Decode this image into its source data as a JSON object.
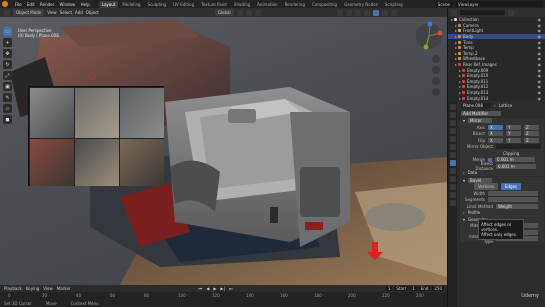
{
  "topbar": {
    "menus": [
      "File",
      "Edit",
      "Render",
      "Window",
      "Help"
    ],
    "workspaces": [
      "Layout",
      "Modeling",
      "Sculpting",
      "UV Editing",
      "Texture Paint",
      "Shading",
      "Animation",
      "Rendering",
      "Compositing",
      "Geometry Nodes",
      "Scripting"
    ],
    "active_workspace": "Layout",
    "scene": "Scene",
    "view_layer": "ViewLayer"
  },
  "viewport_header": {
    "mode": "Object Mode",
    "menus": [
      "View",
      "Select",
      "Add",
      "Object"
    ],
    "orientation": "Global",
    "options": "Options"
  },
  "viewport": {
    "info_line1": "User Perspective",
    "info_line2": "(0) Body | Plane.008"
  },
  "outliner": {
    "items": [
      {
        "label": "Collection",
        "color": "#d6d6d6"
      },
      {
        "label": "Camera",
        "color": "#b28d60"
      },
      {
        "label": "FrontLight",
        "color": "#c8c060"
      },
      {
        "label": "Body",
        "color": "#e08c3a"
      },
      {
        "label": "Tires",
        "color": "#e08c3a"
      },
      {
        "label": "Temp",
        "color": "#e08c3a"
      },
      {
        "label": "Temp.2",
        "color": "#e08c3a"
      },
      {
        "label": "Wheelbase",
        "color": "#e08c3a"
      },
      {
        "label": "Rear Ref. Images",
        "color": "#d04040"
      },
      {
        "label": "Empty.009",
        "color": "#d04040"
      },
      {
        "label": "Empty.010",
        "color": "#d04040"
      },
      {
        "label": "Empty.011",
        "color": "#d04040"
      },
      {
        "label": "Empty.012",
        "color": "#d04040"
      },
      {
        "label": "Empty.013",
        "color": "#d04040"
      },
      {
        "label": "Empty.014",
        "color": "#d04040"
      },
      {
        "label": "Empty.015",
        "color": "#d04040"
      }
    ]
  },
  "properties": {
    "object_name": "Plane.008",
    "mesh_name": "Lattice",
    "add_modifier": "Add Modifier",
    "mirror": {
      "name": "Mirror",
      "axis_label": "Axis",
      "bisect_label": "Bisect",
      "flip_label": "Flip",
      "axes": [
        "X",
        "Y",
        "Z"
      ],
      "mirror_object_label": "Mirror Object",
      "clipping_label": "Clipping",
      "merge_label": "Merge",
      "merge_value": "0.001 m",
      "bisect_distance_label": "Bisect Distance",
      "bisect_distance_value": "0.001 m",
      "data_label": "Data"
    },
    "bevel": {
      "name": "Bevel",
      "tab_vertices": "Vertices",
      "tab_edges": "Edges",
      "width_label": "Width",
      "segments_label": "Segments",
      "limit_method_label": "Limit Method",
      "limit_method_value": "Weight",
      "profile_label": "Profile",
      "geometry_label": "Geometry",
      "miter_outer_label": "Miter Outer",
      "miter_outer_value": "Sharp",
      "inner_label": "Inner",
      "inner_value": "Sharp",
      "intersection_label": "Intersection Type",
      "intersection_value": "Grid Fill"
    },
    "tooltip_line1": "Affect edges or vertices.",
    "tooltip_line2": "Affect only edges."
  },
  "timeline": {
    "menus": [
      "Playback",
      "Keying",
      "View",
      "Marker"
    ],
    "ticks": [
      "0",
      "20",
      "40",
      "60",
      "80",
      "100",
      "120",
      "140",
      "160",
      "180",
      "200",
      "220",
      "240"
    ],
    "current_frame": "1",
    "start_label": "Start",
    "start": "1",
    "end_label": "End",
    "end": "250"
  },
  "status": {
    "select": "Set 3D Cursor",
    "move": "Move",
    "menu": "Context Menu",
    "version": "3.x"
  },
  "watermark": "Udemy"
}
